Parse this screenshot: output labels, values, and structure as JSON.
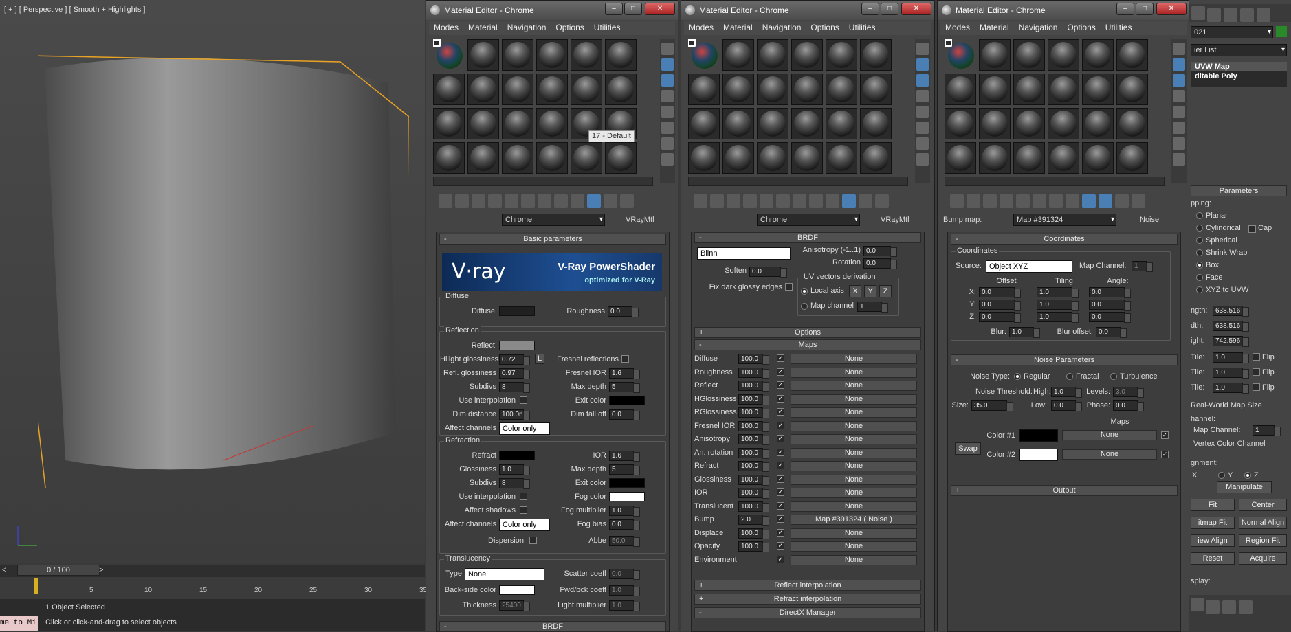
{
  "viewport": {
    "label": "[ + ] [ Perspective ] [ Smooth + Highlights ]",
    "frame": "0 / 100",
    "ticks": [
      "5",
      "10",
      "15",
      "20",
      "25",
      "30",
      "35"
    ],
    "status1": "1 Object Selected",
    "status2": "Click or click-and-drag to select objects",
    "prompt": "me to Mi"
  },
  "win1": {
    "title": "Material Editor - Chrome",
    "menu": [
      "Modes",
      "Material",
      "Navigation",
      "Options",
      "Utilities"
    ],
    "tooltip": "17 - Default",
    "name": "Chrome",
    "type": "VRayMtl",
    "basic_header": "Basic parameters",
    "vray": {
      "brand": "V·ray",
      "title": "V-Ray PowerShader",
      "sub": "optimized for V-Ray"
    },
    "diffuse": {
      "group": "Diffuse",
      "diffuse": "Diffuse",
      "roughness": "Roughness",
      "roughness_val": "0.0"
    },
    "reflection": {
      "group": "Reflection",
      "reflect": "Reflect",
      "hg": "Hilight glossiness",
      "hg_val": "0.72",
      "L": "L",
      "fresnel": "Fresnel reflections",
      "rg": "Refl. glossiness",
      "rg_val": "0.97",
      "fior": "Fresnel IOR",
      "fior_val": "1.6",
      "subdivs": "Subdivs",
      "subdivs_val": "8",
      "maxd": "Max depth",
      "maxd_val": "5",
      "useint": "Use interpolation",
      "exit": "Exit color",
      "dimd": "Dim distance",
      "dimd_val": "100.0n",
      "dimf": "Dim fall off",
      "dimf_val": "0.0",
      "aff": "Affect channels",
      "aff_val": "Color only"
    },
    "refraction": {
      "group": "Refraction",
      "refract": "Refract",
      "ior": "IOR",
      "ior_val": "1.6",
      "gloss": "Glossiness",
      "gloss_val": "1.0",
      "maxd": "Max depth",
      "maxd_val": "5",
      "subdivs": "Subdivs",
      "subdivs_val": "8",
      "exit": "Exit color",
      "useint": "Use interpolation",
      "fog": "Fog color",
      "affsh": "Affect shadows",
      "fogm": "Fog multiplier",
      "fogm_val": "1.0",
      "aff": "Affect channels",
      "aff_val": "Color only",
      "fogb": "Fog bias",
      "fogb_val": "0.0",
      "disp": "Dispersion",
      "abbe": "Abbe",
      "abbe_val": "50.0"
    },
    "translucency": {
      "group": "Translucency",
      "type": "Type",
      "type_val": "None",
      "scatter": "Scatter coeff",
      "scatter_val": "0.0",
      "back": "Back-side color",
      "fwd": "Fwd/bck coeff",
      "fwd_val": "1.0",
      "thick": "Thickness",
      "thick_val": "25400.",
      "light": "Light multiplier",
      "light_val": "1.0"
    },
    "brdf_footer": "BRDF"
  },
  "win2": {
    "title": "Material Editor - Chrome",
    "menu": [
      "Modes",
      "Material",
      "Navigation",
      "Options",
      "Utilities"
    ],
    "name": "Chrome",
    "type": "VRayMtl",
    "brdf": {
      "header": "BRDF",
      "type": "Blinn",
      "aniso": "Anisotropy (-1..1)",
      "aniso_val": "0.0",
      "rot": "Rotation",
      "rot_val": "0.0",
      "soften": "Soften",
      "soften_val": "0.0",
      "uvgrp": "UV vectors derivation",
      "local": "Local axis",
      "x": "X",
      "y": "Y",
      "z": "Z",
      "fix": "Fix dark glossy edges",
      "mapch": "Map channel",
      "mapch_val": "1"
    },
    "options_header": "Options",
    "maps_header": "Maps",
    "maps": [
      {
        "name": "Diffuse",
        "amt": "100.0",
        "slot": "None"
      },
      {
        "name": "Roughness",
        "amt": "100.0",
        "slot": "None"
      },
      {
        "name": "Reflect",
        "amt": "100.0",
        "slot": "None"
      },
      {
        "name": "HGlossiness",
        "amt": "100.0",
        "slot": "None"
      },
      {
        "name": "RGlossiness",
        "amt": "100.0",
        "slot": "None"
      },
      {
        "name": "Fresnel IOR",
        "amt": "100.0",
        "slot": "None"
      },
      {
        "name": "Anisotropy",
        "amt": "100.0",
        "slot": "None"
      },
      {
        "name": "An. rotation",
        "amt": "100.0",
        "slot": "None"
      },
      {
        "name": "Refract",
        "amt": "100.0",
        "slot": "None"
      },
      {
        "name": "Glossiness",
        "amt": "100.0",
        "slot": "None"
      },
      {
        "name": "IOR",
        "amt": "100.0",
        "slot": "None"
      },
      {
        "name": "Translucent",
        "amt": "100.0",
        "slot": "None"
      },
      {
        "name": "Bump",
        "amt": "2.0",
        "slot": "Map #391324  ( Noise )"
      },
      {
        "name": "Displace",
        "amt": "100.0",
        "slot": "None"
      },
      {
        "name": "Opacity",
        "amt": "100.0",
        "slot": "None"
      },
      {
        "name": "Environment",
        "amt": "",
        "slot": "None"
      }
    ],
    "reflint": "Reflect interpolation",
    "refrint": "Refract interpolation",
    "dx": "DirectX Manager"
  },
  "win3": {
    "title": "Material Editor - Chrome",
    "menu": [
      "Modes",
      "Material",
      "Navigation",
      "Options",
      "Utilities"
    ],
    "bumplbl": "Bump map:",
    "name": "Map #391324",
    "type": "Noise",
    "coords": {
      "header": "Coordinates",
      "group": "Coordinates",
      "source": "Source:",
      "source_val": "Object XYZ",
      "mapch": "Map Channel:",
      "mapch_val": "1",
      "offset": "Offset",
      "tiling": "Tiling",
      "angle": "Angle:",
      "rows": [
        {
          "ax": "X:",
          "o": "0.0",
          "t": "1.0",
          "a": "0.0"
        },
        {
          "ax": "Y:",
          "o": "0.0",
          "t": "1.0",
          "a": "0.0"
        },
        {
          "ax": "Z:",
          "o": "0.0",
          "t": "1.0",
          "a": "0.0"
        }
      ],
      "blur": "Blur:",
      "blur_val": "1.0",
      "bluro": "Blur offset:",
      "bluro_val": "0.0"
    },
    "noise": {
      "header": "Noise Parameters",
      "ntype": "Noise Type:",
      "regular": "Regular",
      "fractal": "Fractal",
      "turb": "Turbulence",
      "thr": "Noise Threshold:",
      "high": "High:",
      "high_val": "1.0",
      "levels": "Levels:",
      "levels_val": "3.0",
      "size": "Size:",
      "size_val": "35.0",
      "low": "Low:",
      "low_val": "0.0",
      "phase": "Phase:",
      "phase_val": "0.0",
      "maps": "Maps",
      "c1": "Color #1",
      "c2": "Color #2",
      "none1": "None",
      "none2": "None",
      "swap": "Swap"
    },
    "output": "Output"
  },
  "cmd": {
    "obj": "021",
    "modlist": "ier List",
    "stack": [
      "UVW Map",
      "ditable Poly"
    ],
    "params": "Parameters",
    "mapping": "pping:",
    "types": [
      "Planar",
      "Cylindrical",
      "Spherical",
      "Shrink Wrap",
      "Box",
      "Face",
      "XYZ to UVW"
    ],
    "cap": "Cap",
    "len": "ngth:",
    "len_val": "638.516",
    "wid": "dth:",
    "wid_val": "638.516",
    "hei": "ight:",
    "hei_val": "742.596",
    "tiles": [
      {
        "l": "Tile:",
        "v": "1.0"
      },
      {
        "l": "Tile:",
        "v": "1.0"
      },
      {
        "l": "Tile:",
        "v": "1.0"
      }
    ],
    "flip": "Flip",
    "rw": "Real-World Map Size",
    "channel": "hannel:",
    "mapch": "Map Channel:",
    "mapch_val": "1",
    "vcc": "Vertex Color Channel",
    "align": "gnment:",
    "x": "X",
    "y": "Y",
    "z": "Z",
    "manip": "Manipulate",
    "fit": "Fit",
    "center": "Center",
    "bfit": "itmap Fit",
    "nalign": "Normal Align",
    "valign": "iew Align",
    "rfit": "Region Fit",
    "reset": "Reset",
    "acquire": "Acquire",
    "display": "splay:"
  }
}
